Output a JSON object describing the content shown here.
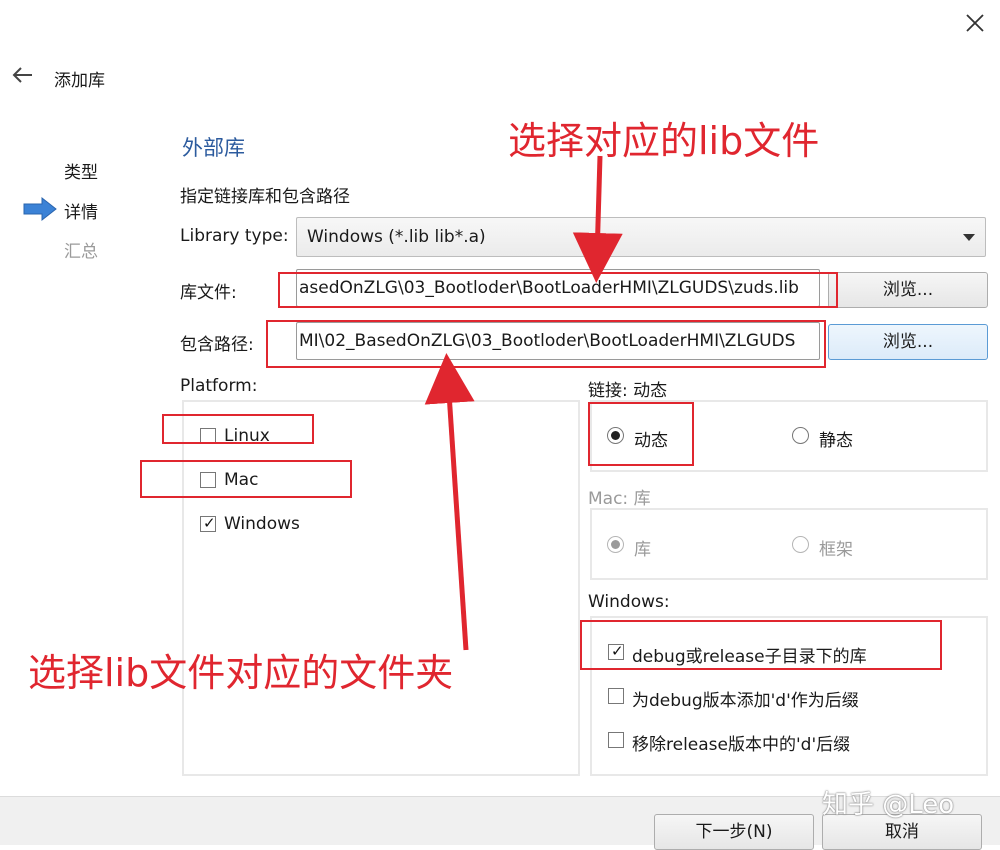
{
  "window": {
    "close_icon": "close-icon"
  },
  "header": {
    "back_icon": "arrow-left-icon",
    "title": "添加库"
  },
  "steps": [
    {
      "label": "类型",
      "state": "done"
    },
    {
      "label": "详情",
      "state": "current"
    },
    {
      "label": "汇总",
      "state": "pending"
    }
  ],
  "section": {
    "title": "外部库",
    "subtitle": "指定链接库和包含路径"
  },
  "library_type": {
    "label": "Library type:",
    "value": "Windows (*.lib lib*.a)"
  },
  "library_file": {
    "label": "库文件:",
    "value": "asedOnZLG\\03_Bootloder\\BootLoaderHMI\\ZLGUDS\\zuds.lib",
    "browse": "浏览..."
  },
  "include_path": {
    "label": "包含路径:",
    "value": "MI\\02_BasedOnZLG\\03_Bootloder\\BootLoaderHMI\\ZLGUDS",
    "browse": "浏览..."
  },
  "platform": {
    "label": "Platform:",
    "items": [
      {
        "label": "Linux",
        "checked": false
      },
      {
        "label": "Mac",
        "checked": false
      },
      {
        "label": "Windows",
        "checked": true
      }
    ]
  },
  "linkage": {
    "label": "链接:  动态",
    "options": [
      {
        "label": "动态",
        "selected": true
      },
      {
        "label": "静态",
        "selected": false
      }
    ]
  },
  "mac": {
    "label": "Mac:  库",
    "options": [
      {
        "label": "库",
        "selected": true
      },
      {
        "label": "框架",
        "selected": false
      }
    ]
  },
  "windows": {
    "label": "Windows:",
    "items": [
      {
        "label": "debug或release子目录下的库",
        "checked": true
      },
      {
        "label": "为debug版本添加'd'作为后缀",
        "checked": false
      },
      {
        "label": "移除release版本中的'd'后缀",
        "checked": false
      }
    ]
  },
  "annotations": {
    "top": "选择对应的lib文件",
    "bottom": "选择lib文件对应的文件夹",
    "color": "#e0262f"
  },
  "footer": {
    "next": "下一步(N)",
    "cancel": "取消"
  },
  "watermark": "知乎 @Leo",
  "colors": {
    "accent": "#2c5b9e",
    "annotation": "#e0262f",
    "step_arrow": "#3b82d6"
  }
}
